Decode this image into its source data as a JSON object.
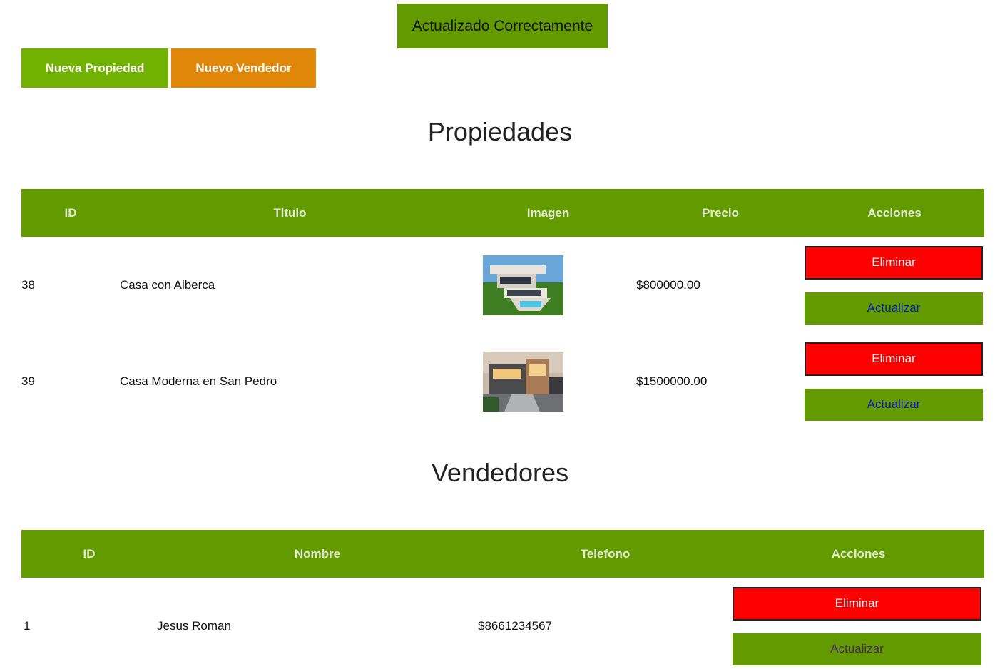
{
  "alert": {
    "message": "Actualizado Correctamente"
  },
  "buttons": {
    "new_property": "Nueva Propiedad",
    "new_seller": "Nuevo Vendedor"
  },
  "properties": {
    "title": "Propiedades",
    "headers": [
      "ID",
      "Titulo",
      "Imagen",
      "Precio",
      "Acciones"
    ],
    "rows": [
      {
        "id": "38",
        "title": "Casa con Alberca",
        "image": "house-with-pool-thumbnail",
        "price": "$800000.00",
        "delete_label": "Eliminar",
        "update_label": "Actualizar"
      },
      {
        "id": "39",
        "title": "Casa Moderna en San Pedro",
        "image": "modern-house-thumbnail",
        "price": "$1500000.00",
        "delete_label": "Eliminar",
        "update_label": "Actualizar"
      }
    ]
  },
  "sellers": {
    "title": "Vendedores",
    "headers": [
      "ID",
      "Nombre",
      "Telefono",
      "Acciones"
    ],
    "rows": [
      {
        "id": "1",
        "name": "Jesus Roman",
        "phone": "$8661234567",
        "delete_label": "Eliminar",
        "update_label": "Actualizar"
      }
    ]
  },
  "colors": {
    "green": "#629a00",
    "light_green": "#71b100",
    "orange": "#e08709",
    "red": "#ff0000"
  }
}
